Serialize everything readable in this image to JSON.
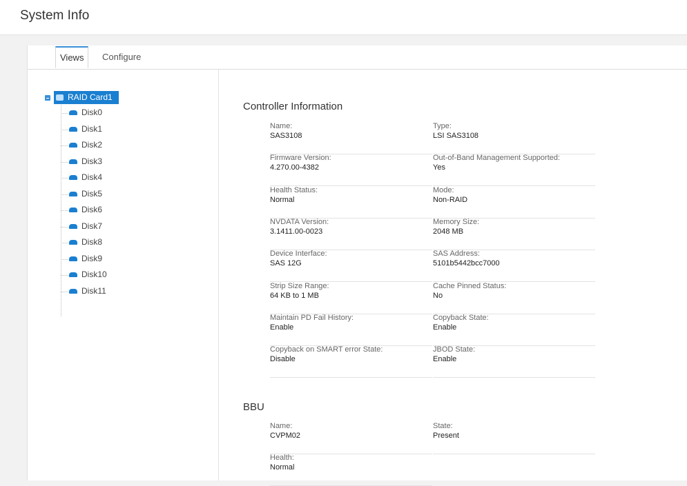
{
  "page": {
    "title": "System Info"
  },
  "tabs": [
    {
      "label": "Views",
      "active": true
    },
    {
      "label": "Configure",
      "active": false
    }
  ],
  "tree": {
    "root": {
      "label": "RAID Card1",
      "expanded": true
    },
    "items": [
      {
        "label": "Disk0"
      },
      {
        "label": "Disk1"
      },
      {
        "label": "Disk2"
      },
      {
        "label": "Disk3"
      },
      {
        "label": "Disk4"
      },
      {
        "label": "Disk5"
      },
      {
        "label": "Disk6"
      },
      {
        "label": "Disk7"
      },
      {
        "label": "Disk8"
      },
      {
        "label": "Disk9"
      },
      {
        "label": "Disk10"
      },
      {
        "label": "Disk11"
      }
    ]
  },
  "controller": {
    "title": "Controller Information",
    "fields": [
      {
        "label": "Name:",
        "value": "SAS3108"
      },
      {
        "label": "Type:",
        "value": "LSI SAS3108"
      },
      {
        "label": "Firmware Version:",
        "value": "4.270.00-4382"
      },
      {
        "label": "Out-of-Band Management Supported:",
        "value": "Yes"
      },
      {
        "label": "Health Status:",
        "value": "Normal"
      },
      {
        "label": "Mode:",
        "value": "Non-RAID"
      },
      {
        "label": "NVDATA Version:",
        "value": "3.1411.00-0023"
      },
      {
        "label": "Memory Size:",
        "value": "2048 MB"
      },
      {
        "label": "Device Interface:",
        "value": "SAS 12G"
      },
      {
        "label": "SAS Address:",
        "value": "5101b5442bcc7000"
      },
      {
        "label": "Strip Size Range:",
        "value": "64 KB to 1 MB"
      },
      {
        "label": "Cache Pinned Status:",
        "value": "No"
      },
      {
        "label": "Maintain PD Fail History:",
        "value": "Enable"
      },
      {
        "label": "Copyback State:",
        "value": "Enable"
      },
      {
        "label": "Copyback on SMART error State:",
        "value": "Disable"
      },
      {
        "label": "JBOD State:",
        "value": "Enable"
      }
    ]
  },
  "bbu": {
    "title": "BBU",
    "fields": [
      {
        "label": "Name:",
        "value": "CVPM02"
      },
      {
        "label": "State:",
        "value": "Present"
      },
      {
        "label": "Health:",
        "value": "Normal"
      }
    ]
  },
  "colors": {
    "accent": "#1a7fd0",
    "tab_indicator": "#3a8fd8"
  }
}
